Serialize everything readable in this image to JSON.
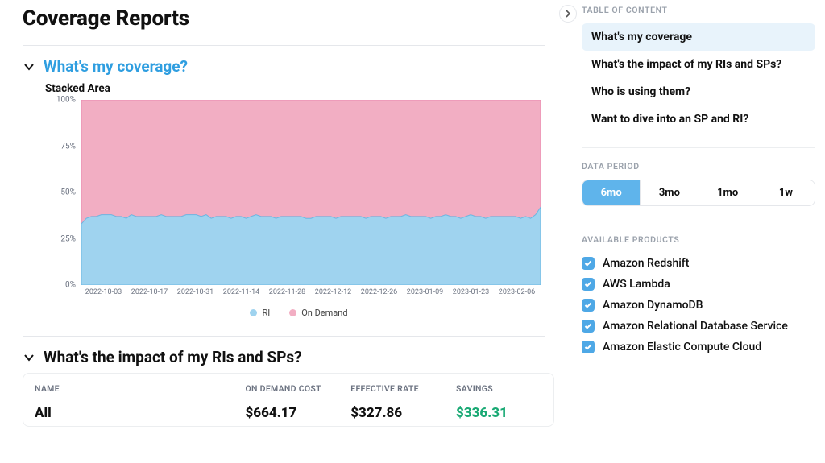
{
  "page": {
    "title": "Coverage Reports"
  },
  "sections": {
    "coverage": {
      "title": "What's my coverage?"
    },
    "impact": {
      "title": "What's the impact of my RIs and SPs?"
    }
  },
  "chart_title": "Stacked Area",
  "chart_data": {
    "type": "area",
    "stacked": true,
    "ylabel": "",
    "xlabel": "",
    "ylim": [
      0,
      100
    ],
    "y_ticks": [
      "0%",
      "25%",
      "50%",
      "75%",
      "100%"
    ],
    "categories": [
      "2022-10-03",
      "2022-10-17",
      "2022-10-31",
      "2022-11-14",
      "2022-11-28",
      "2022-12-12",
      "2022-12-26",
      "2023-01-09",
      "2023-01-23",
      "2023-02-06"
    ],
    "series": [
      {
        "name": "RI",
        "color": "#9fd3ef",
        "values": [
          33,
          36,
          37,
          37,
          38,
          38,
          38,
          37,
          37,
          36,
          38,
          37,
          37,
          37,
          37,
          37,
          38,
          37,
          37,
          37,
          37,
          38,
          38,
          38,
          37,
          38,
          36,
          37,
          37,
          37,
          36,
          37,
          37,
          36,
          37,
          38,
          37,
          37,
          37,
          36,
          37,
          37,
          37,
          37,
          37,
          36,
          36,
          37,
          37,
          37,
          37,
          36,
          37,
          37,
          37,
          37,
          37,
          36,
          37,
          37,
          37,
          36,
          37,
          37,
          37,
          38,
          37,
          37,
          37,
          37,
          36,
          37,
          37,
          38,
          37,
          37,
          36,
          37,
          38,
          37,
          37,
          36,
          37,
          37,
          37,
          37,
          37,
          37,
          36,
          37,
          36,
          38,
          42
        ]
      },
      {
        "name": "On Demand",
        "color": "#f2aec3",
        "values": [
          67,
          64,
          63,
          63,
          62,
          62,
          62,
          63,
          63,
          64,
          62,
          63,
          63,
          63,
          63,
          63,
          62,
          63,
          63,
          63,
          63,
          62,
          62,
          62,
          63,
          62,
          64,
          63,
          63,
          63,
          64,
          63,
          63,
          64,
          63,
          62,
          63,
          63,
          63,
          64,
          63,
          63,
          63,
          63,
          63,
          64,
          64,
          63,
          63,
          63,
          63,
          64,
          63,
          63,
          63,
          63,
          63,
          64,
          63,
          63,
          63,
          64,
          63,
          63,
          63,
          62,
          63,
          63,
          63,
          63,
          64,
          63,
          63,
          62,
          63,
          63,
          64,
          63,
          62,
          63,
          63,
          64,
          63,
          63,
          63,
          63,
          63,
          63,
          64,
          63,
          64,
          62,
          58
        ]
      }
    ],
    "legend": [
      {
        "label": "RI",
        "color": "#9fd3ef"
      },
      {
        "label": "On Demand",
        "color": "#f2aec3"
      }
    ]
  },
  "impact_table": {
    "columns": [
      "NAME",
      "ON DEMAND COST",
      "EFFECTIVE RATE",
      "SAVINGS"
    ],
    "rows": [
      {
        "name": "All",
        "on_demand": "$664.17",
        "effective": "$327.86",
        "savings": "$336.31"
      }
    ]
  },
  "sidebar": {
    "toc_heading": "TABLE OF CONTENT",
    "toc": [
      {
        "label": "What's my coverage",
        "active": true
      },
      {
        "label": "What's the impact of my RIs and SPs?",
        "active": false
      },
      {
        "label": "Who is using them?",
        "active": false
      },
      {
        "label": "Want to dive into an SP and RI?",
        "active": false
      }
    ],
    "period_heading": "DATA PERIOD",
    "periods": [
      {
        "label": "6mo",
        "active": true
      },
      {
        "label": "3mo",
        "active": false
      },
      {
        "label": "1mo",
        "active": false
      },
      {
        "label": "1w",
        "active": false
      }
    ],
    "products_heading": "AVAILABLE PRODUCTS",
    "products": [
      {
        "label": "Amazon Redshift",
        "checked": true
      },
      {
        "label": "AWS Lambda",
        "checked": true
      },
      {
        "label": "Amazon DynamoDB",
        "checked": true
      },
      {
        "label": "Amazon Relational Database Service",
        "checked": true
      },
      {
        "label": "Amazon Elastic Compute Cloud",
        "checked": true
      }
    ]
  }
}
